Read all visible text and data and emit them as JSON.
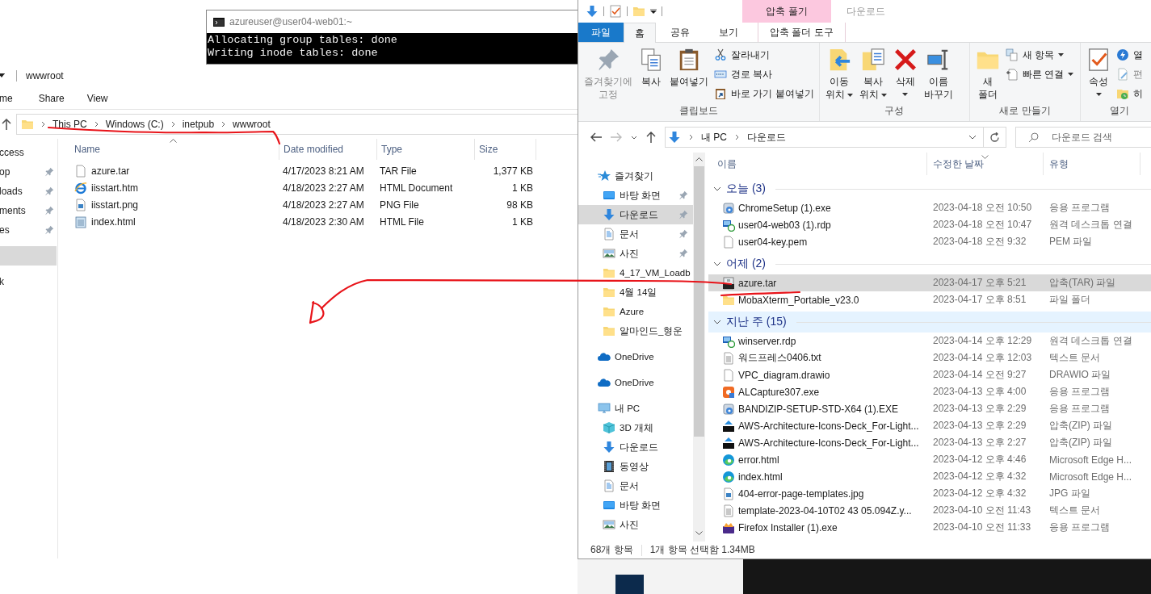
{
  "terminal": {
    "title": "azureuser@user04-web01:~",
    "lines": [
      "Allocating group tables: done",
      "Writing inode tables: done"
    ]
  },
  "left_explorer": {
    "title": "wwwroot",
    "ribbon_tabs": [
      "me",
      "Share",
      "View"
    ],
    "breadcrumb": [
      "This PC",
      "Windows (C:)",
      "inetpub",
      "wwwroot"
    ],
    "nav_items": [
      {
        "kind": "section",
        "label": "ccess",
        "pinned": false,
        "selected": false
      },
      {
        "kind": "item",
        "label": "op",
        "pinned": true,
        "selected": false
      },
      {
        "kind": "item",
        "label": "loads",
        "pinned": true,
        "selected": false
      },
      {
        "kind": "item",
        "label": "ments",
        "pinned": true,
        "selected": false
      },
      {
        "kind": "item",
        "label": "es",
        "pinned": true,
        "selected": false
      },
      {
        "kind": "blank",
        "selected": true
      },
      {
        "kind": "section",
        "label": "k",
        "pinned": false,
        "selected": false
      }
    ],
    "columns": [
      "Name",
      "Date modified",
      "Type",
      "Size"
    ],
    "files": [
      {
        "kind": "file",
        "name": "azure.tar",
        "date": "4/17/2023 8:21 AM",
        "type": "TAR File",
        "size": "1,377 KB"
      },
      {
        "kind": "ie",
        "name": "iisstart.htm",
        "date": "4/18/2023 2:27 AM",
        "type": "HTML Document",
        "size": "1 KB"
      },
      {
        "kind": "image",
        "name": "iisstart.png",
        "date": "4/18/2023 2:27 AM",
        "type": "PNG File",
        "size": "98 KB"
      },
      {
        "kind": "notepad",
        "name": "index.html",
        "date": "4/18/2023 2:30 AM",
        "type": "HTML File",
        "size": "1 KB"
      }
    ]
  },
  "right_explorer": {
    "title": "다운로드",
    "contextual_tab": "압축 풀기",
    "tabs": [
      {
        "kind": "file",
        "label": "파일",
        "selected": false
      },
      {
        "kind": "tab",
        "label": "홈",
        "selected": true
      },
      {
        "kind": "tab",
        "label": "공유",
        "selected": false
      },
      {
        "kind": "tab",
        "label": "보기",
        "selected": false
      },
      {
        "kind": "context",
        "label": "압축 폴더 도구",
        "selected": false
      }
    ],
    "ribbon": [
      {
        "label": "클립보드",
        "large": [
          {
            "label": "즐겨찾기에\n고정",
            "disabled": true,
            "dropdown": false
          },
          {
            "label": "복사",
            "disabled": false,
            "dropdown": false
          },
          {
            "label": "붙여넣기",
            "disabled": false,
            "dropdown": false
          }
        ],
        "small": [
          {
            "label": "잘라내기",
            "disabled": false,
            "dropdown": false
          },
          {
            "label": "경로 복사",
            "disabled": false,
            "dropdown": false
          },
          {
            "label": "바로 가기 붙여넣기",
            "disabled": false,
            "dropdown": false
          }
        ]
      },
      {
        "label": "구성",
        "large": [
          {
            "label": "이동\n위치",
            "disabled": false,
            "dropdown": true
          },
          {
            "label": "복사\n위치",
            "disabled": false,
            "dropdown": true
          },
          {
            "label": "삭제",
            "disabled": false,
            "dropdown": true
          },
          {
            "label": "이름\n바꾸기",
            "disabled": false,
            "dropdown": false
          }
        ]
      },
      {
        "label": "새로 만들기",
        "large": [
          {
            "label": "새\n폴더",
            "disabled": false,
            "dropdown": false
          }
        ],
        "small": [
          {
            "label": "새 항목",
            "disabled": false,
            "dropdown": true
          },
          {
            "label": "빠른 연결",
            "disabled": false,
            "dropdown": true
          }
        ]
      },
      {
        "label": "열기",
        "large": [
          {
            "label": "속성",
            "disabled": false,
            "dropdown": true
          }
        ],
        "small": [
          {
            "label": "열",
            "disabled": false,
            "dropdown": false
          },
          {
            "label": "편",
            "disabled": true,
            "dropdown": false
          },
          {
            "label": "히",
            "disabled": false,
            "dropdown": false
          }
        ]
      }
    ],
    "path": [
      "내 PC",
      "다운로드"
    ],
    "search": {
      "placeholder": "다운로드 검색"
    },
    "nav": [
      {
        "kind": "star",
        "label": "즐겨찾기",
        "selected": false,
        "children": [
          {
            "kind": "desktop",
            "label": "바탕 화면",
            "selected": false,
            "pinned": true
          },
          {
            "kind": "download",
            "label": "다운로드",
            "selected": true,
            "pinned": true
          },
          {
            "kind": "document",
            "label": "문서",
            "selected": false,
            "pinned": true
          },
          {
            "kind": "picture",
            "label": "사진",
            "selected": false,
            "pinned": true
          },
          {
            "kind": "folder",
            "label": "4_17_VM_Loadb",
            "selected": false,
            "pinned": false
          },
          {
            "kind": "folder",
            "label": "4월 14일",
            "selected": false,
            "pinned": false
          },
          {
            "kind": "folder",
            "label": "Azure",
            "selected": false,
            "pinned": false
          },
          {
            "kind": "folder",
            "label": "알마인드_형운",
            "selected": false,
            "pinned": false
          }
        ]
      },
      {
        "kind": "cloud",
        "label": "OneDrive",
        "selected": false
      },
      {
        "kind": "cloud",
        "label": "OneDrive",
        "selected": false
      },
      {
        "kind": "pc",
        "label": "내 PC",
        "selected": false,
        "children": [
          {
            "kind": "cube",
            "label": "3D 개체",
            "selected": false,
            "pinned": false
          },
          {
            "kind": "download",
            "label": "다운로드",
            "selected": false,
            "pinned": false
          },
          {
            "kind": "video",
            "label": "동영상",
            "selected": false,
            "pinned": false
          },
          {
            "kind": "document",
            "label": "문서",
            "selected": false,
            "pinned": false
          },
          {
            "kind": "desktop",
            "label": "바탕 화면",
            "selected": false,
            "pinned": false
          },
          {
            "kind": "picture",
            "label": "사진",
            "selected": false,
            "pinned": false
          }
        ]
      }
    ],
    "columns": [
      "이름",
      "수정한 날짜",
      "유형"
    ],
    "groups": [
      {
        "label": "오늘 (3)",
        "focused": false,
        "files": [
          {
            "kind": "installer",
            "name": "ChromeSetup (1).exe",
            "date": "2023-04-18 오전 10:50",
            "type": "응용 프로그램",
            "selected": false
          },
          {
            "kind": "rdp",
            "name": "user04-web03 (1).rdp",
            "date": "2023-04-18 오전 10:47",
            "type": "원격 데스크톱 연결",
            "selected": false
          },
          {
            "kind": "file",
            "name": "user04-key.pem",
            "date": "2023-04-18 오전 9:32",
            "type": "PEM 파일",
            "selected": false
          }
        ]
      },
      {
        "label": "어제 (2)",
        "focused": false,
        "files": [
          {
            "kind": "tar",
            "name": "azure.tar",
            "date": "2023-04-17 오후 5:21",
            "type": "압축(TAR) 파일",
            "selected": true
          },
          {
            "kind": "folder",
            "name": "MobaXterm_Portable_v23.0",
            "date": "2023-04-17 오후 8:51",
            "type": "파일 폴더",
            "selected": false
          }
        ]
      },
      {
        "label": "지난 주 (15)",
        "focused": true,
        "files": [
          {
            "kind": "rdp",
            "name": "winserver.rdp",
            "date": "2023-04-14 오후 12:29",
            "type": "원격 데스크톱 연결",
            "selected": false
          },
          {
            "kind": "text",
            "name": "워드프레스0406.txt",
            "date": "2023-04-14 오후 12:03",
            "type": "텍스트 문서",
            "selected": false
          },
          {
            "kind": "file",
            "name": "VPC_diagram.drawio",
            "date": "2023-04-14 오전 9:27",
            "type": "DRAWIO 파일",
            "selected": false
          },
          {
            "kind": "app",
            "name": "ALCapture307.exe",
            "date": "2023-04-13 오후 4:00",
            "type": "응용 프로그램",
            "selected": false
          },
          {
            "kind": "installer",
            "name": "BANDIZIP-SETUP-STD-X64 (1).EXE",
            "date": "2023-04-13 오후 2:29",
            "type": "응용 프로그램",
            "selected": false
          },
          {
            "kind": "zip",
            "name": "AWS-Architecture-Icons-Deck_For-Light...",
            "date": "2023-04-13 오후 2:29",
            "type": "압축(ZIP) 파일",
            "selected": false
          },
          {
            "kind": "zip",
            "name": "AWS-Architecture-Icons-Deck_For-Light...",
            "date": "2023-04-13 오후 2:27",
            "type": "압축(ZIP) 파일",
            "selected": false
          },
          {
            "kind": "edge",
            "name": "error.html",
            "date": "2023-04-12 오후 4:46",
            "type": "Microsoft Edge H...",
            "selected": false
          },
          {
            "kind": "edge",
            "name": "index.html",
            "date": "2023-04-12 오후 4:32",
            "type": "Microsoft Edge H...",
            "selected": false
          },
          {
            "kind": "image",
            "name": "404-error-page-templates.jpg",
            "date": "2023-04-12 오후 4:32",
            "type": "JPG 파일",
            "selected": false
          },
          {
            "kind": "text",
            "name": "template-2023-04-10T02 43 05.094Z.y...",
            "date": "2023-04-10 오전 11:43",
            "type": "텍스트 문서",
            "selected": false
          },
          {
            "kind": "firefox",
            "name": "Firefox Installer (1).exe",
            "date": "2023-04-10 오전 11:33",
            "type": "응용 프로그램",
            "selected": false
          }
        ]
      }
    ],
    "status": [
      "68개 항목",
      "1개 항목 선택함 1.34MB"
    ]
  }
}
